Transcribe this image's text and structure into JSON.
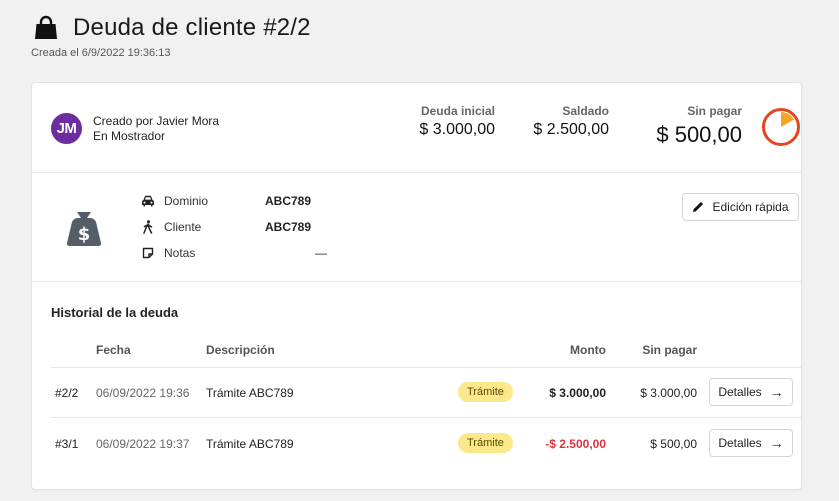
{
  "header": {
    "title": "Deuda de cliente #2/2",
    "created_at": "Creada el 6/9/2022 19:36:13"
  },
  "summary": {
    "avatar_initials": "JM",
    "created_by": "Creado por Javier Mora",
    "location": "En Mostrador",
    "initial_debt_label": "Deuda inicial",
    "initial_debt_value": "$ 3.000,00",
    "paid_label": "Saldado",
    "paid_value": "$ 2.500,00",
    "unpaid_label": "Sin pagar",
    "unpaid_value": "$ 500,00",
    "unpaid_fraction": 0.1667,
    "pie_color": "#e8431f",
    "pie_fill_color": "#f5a623"
  },
  "details": {
    "fields": [
      {
        "label": "Dominio",
        "value": "ABC789",
        "icon": "car-icon"
      },
      {
        "label": "Cliente",
        "value": "ABC789",
        "icon": "person-walking-icon"
      },
      {
        "label": "Notas",
        "value": "—",
        "icon": "note-icon"
      }
    ],
    "quick_edit_label": "Edición rápida"
  },
  "history": {
    "title": "Historial de la deuda",
    "columns": {
      "date": "Fecha",
      "description": "Descripción",
      "amount": "Monto",
      "unpaid": "Sin pagar"
    },
    "rows": [
      {
        "id": "#2/2",
        "date": "06/09/2022 19:36",
        "description": "Trámite ABC789",
        "type": "Trámite",
        "amount": "$ 3.000,00",
        "negative": false,
        "unpaid": "$ 3.000,00",
        "action": "Detalles"
      },
      {
        "id": "#3/1",
        "date": "06/09/2022 19:37",
        "description": "Trámite ABC789",
        "type": "Trámite",
        "amount": "-$ 2.500,00",
        "negative": true,
        "unpaid": "$ 500,00",
        "action": "Detalles"
      }
    ]
  }
}
